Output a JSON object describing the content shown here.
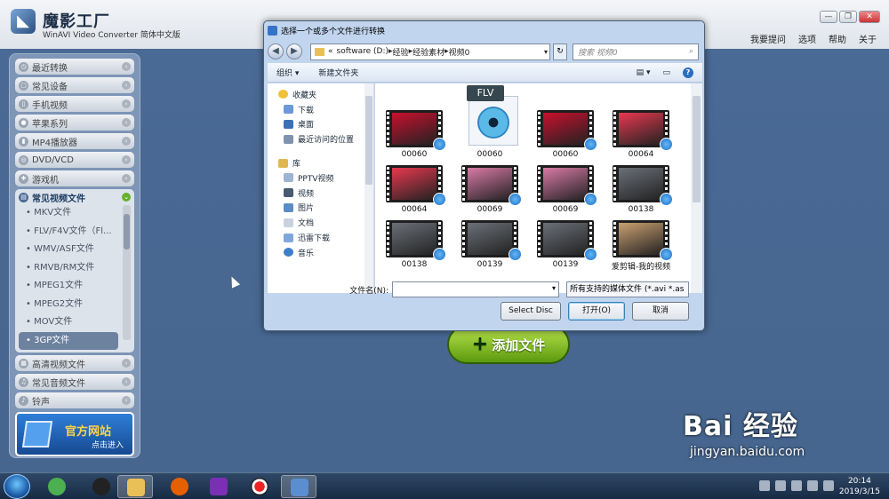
{
  "app": {
    "brand_name": "魔影工厂",
    "brand_sub": "WinAVI Video Converter 简体中文版",
    "top_menu": [
      "我要提问",
      "选项",
      "帮助",
      "关于"
    ],
    "window_buttons": [
      "—",
      "❐",
      "✕"
    ]
  },
  "sidebar": {
    "items_top": [
      {
        "label": "最近转换",
        "icon": "clock-icon"
      },
      {
        "label": "常见设备",
        "icon": "device-icon"
      },
      {
        "label": "手机视频",
        "icon": "phone-icon"
      },
      {
        "label": "苹果系列",
        "icon": "apple-icon"
      },
      {
        "label": "MP4播放器",
        "icon": "mp4-icon"
      },
      {
        "label": "DVD/VCD",
        "icon": "disc-icon"
      },
      {
        "label": "游戏机",
        "icon": "gamepad-icon"
      }
    ],
    "expanded": {
      "label": "常见视频文件",
      "items": [
        "• MKV文件",
        "• FLV/F4V文件（Fl...",
        "• WMV/ASF文件",
        "• RMVB/RM文件",
        "• MPEG1文件",
        "• MPEG2文件",
        "• MOV文件",
        "• 3GP文件"
      ],
      "selected": "• 3GP文件"
    },
    "items_bottom": [
      {
        "label": "高清视频文件",
        "icon": "hd-icon"
      },
      {
        "label": "常见音频文件",
        "icon": "music-icon"
      },
      {
        "label": "铃声",
        "icon": "bell-icon"
      }
    ],
    "banner": {
      "title": "官方网站",
      "sub": "点击进入"
    }
  },
  "main": {
    "add_button": "添加文件",
    "add_icon": "+"
  },
  "dialog": {
    "title": "选择一个或多个文件进行转换",
    "breadcrumb_prefix": "«",
    "breadcrumb": [
      "software (D:)",
      "经验",
      "经验素材",
      "视频0"
    ],
    "search_placeholder": "搜索 视频0",
    "toolbar": {
      "organize": "组织 ▾",
      "new_folder": "新建文件夹"
    },
    "nav": {
      "favorites_header": "收藏夹",
      "favorites": [
        "下载",
        "桌面",
        "最近访问的位置"
      ],
      "library_header": "库",
      "library": [
        "PPTV视频",
        "视频",
        "图片",
        "文档",
        "迅雷下载",
        "音乐"
      ]
    },
    "files": [
      {
        "name": "00060",
        "kind": "video",
        "scene": "red"
      },
      {
        "name": "00060",
        "kind": "flv",
        "tag": "FLV"
      },
      {
        "name": "00060",
        "kind": "video",
        "scene": "red"
      },
      {
        "name": "00064",
        "kind": "video",
        "scene": "redlight"
      },
      {
        "name": "00064",
        "kind": "video",
        "scene": "redlight"
      },
      {
        "name": "00069",
        "kind": "video",
        "scene": "pink"
      },
      {
        "name": "00069",
        "kind": "video",
        "scene": "pink"
      },
      {
        "name": "00138",
        "kind": "video",
        "scene": "car"
      },
      {
        "name": "00138",
        "kind": "video",
        "scene": "car"
      },
      {
        "name": "00139",
        "kind": "video",
        "scene": "car"
      },
      {
        "name": "00139",
        "kind": "video",
        "scene": "car"
      },
      {
        "name": "爱剪辑-我的视频",
        "kind": "video",
        "scene": "desert"
      }
    ],
    "filename_label": "文件名(N):",
    "filename_value": "",
    "filetype": "所有支持的媒体文件 (*.avi *.as",
    "buttons": {
      "select_disc": "Select Disc",
      "open": "打开(O)",
      "cancel": "取消"
    }
  },
  "taskbar": {
    "clock_time": "20:14",
    "clock_date": "2019/3/15"
  },
  "watermark": {
    "main": "Bai 经验",
    "sub": "jingyan.baidu.com"
  },
  "colors": {
    "scene_red": "#c8102e",
    "scene_redlight": "#e8384f",
    "scene_pink": "#d97aa6",
    "scene_car": "#6b7077",
    "scene_desert": "#caa070",
    "accent_green": "#5c9a0e"
  }
}
